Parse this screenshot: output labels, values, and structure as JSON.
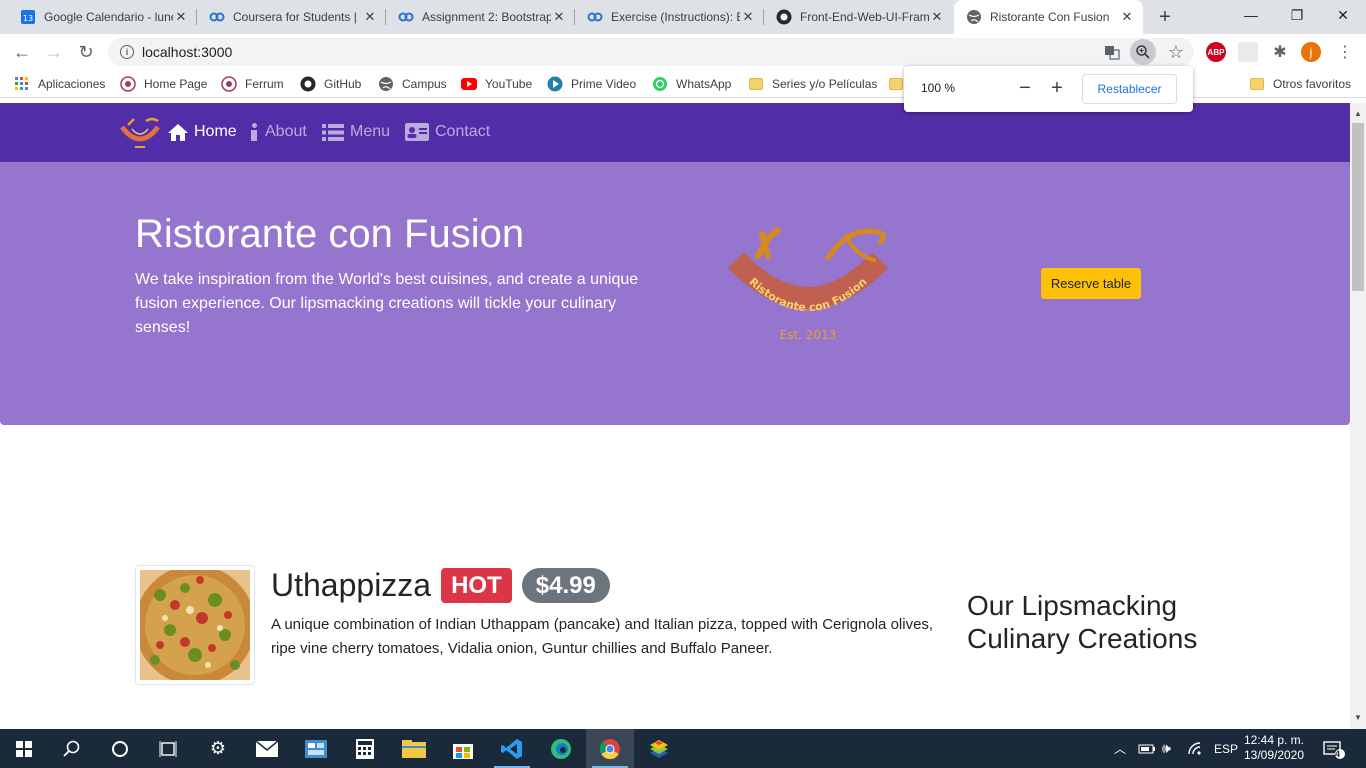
{
  "browser": {
    "tabs": [
      {
        "title": "Google Calendario - lunes",
        "icon": "calendar-icon",
        "badge": "13"
      },
      {
        "title": "Coursera for Students |",
        "icon": "coursera-icon"
      },
      {
        "title": "Assignment 2: Bootstrap",
        "icon": "coursera-icon"
      },
      {
        "title": "Exercise (Instructions): B",
        "icon": "coursera-icon"
      },
      {
        "title": "Front-End-Web-UI-Frame",
        "icon": "github-icon"
      },
      {
        "title": "Ristorante Con Fusion",
        "icon": "globe-icon"
      }
    ],
    "url": "localhost:3000",
    "profile_initial": "j",
    "adblock_label": "ABP",
    "bookmarks": [
      {
        "label": "Aplicaciones",
        "icon": "apps-grid-icon"
      },
      {
        "label": "Home Page",
        "icon": "ferrum-icon"
      },
      {
        "label": "Ferrum",
        "icon": "ferrum-icon"
      },
      {
        "label": "GitHub",
        "icon": "github-icon"
      },
      {
        "label": "Campus",
        "icon": "globe-icon"
      },
      {
        "label": "YouTube",
        "icon": "youtube-icon"
      },
      {
        "label": "Prime Video",
        "icon": "prime-video-icon"
      },
      {
        "label": "WhatsApp",
        "icon": "whatsapp-icon"
      },
      {
        "label": "Series y/o Películas",
        "icon": "folder-icon"
      },
      {
        "label": "Otros favoritos",
        "icon": "folder-icon"
      }
    ],
    "zoom_popup": {
      "level": "100 %",
      "reset_label": "Restablecer"
    }
  },
  "site": {
    "nav": [
      {
        "label": "Home",
        "icon": "home-icon",
        "active": true
      },
      {
        "label": "About",
        "icon": "info-icon",
        "active": false
      },
      {
        "label": "Menu",
        "icon": "list-icon",
        "active": false
      },
      {
        "label": "Contact",
        "icon": "address-card-icon",
        "active": false
      }
    ],
    "jumbotron": {
      "title": "Ristorante con Fusion",
      "description": "We take inspiration from the World's best cuisines, and create a unique fusion experience. Our lipsmacking creations will tickle your culinary senses!",
      "logo_text": "Ristorante con Fusion",
      "logo_est": "Est. 2013",
      "reserve_label": "Reserve table"
    },
    "dish": {
      "name": "Uthappizza",
      "badge": "HOT",
      "price": "$4.99",
      "description": "A unique combination of Indian Uthappam (pancake) and Italian pizza, topped with Cerignola olives, ripe vine cherry tomatoes, Vidalia onion, Guntur chillies and Buffalo Paneer."
    },
    "aside_title": "Our Lipsmacking Culinary Creations"
  },
  "taskbar": {
    "language": "ESP",
    "time": "12:44 p. m.",
    "date": "13/09/2020",
    "notifications": "4"
  },
  "colors": {
    "navbar": "#512da8",
    "jumbotron": "#9575cd",
    "reserve_button": "#ffc107",
    "hot_badge": "#dc3545",
    "price_badge": "#6c757d"
  }
}
